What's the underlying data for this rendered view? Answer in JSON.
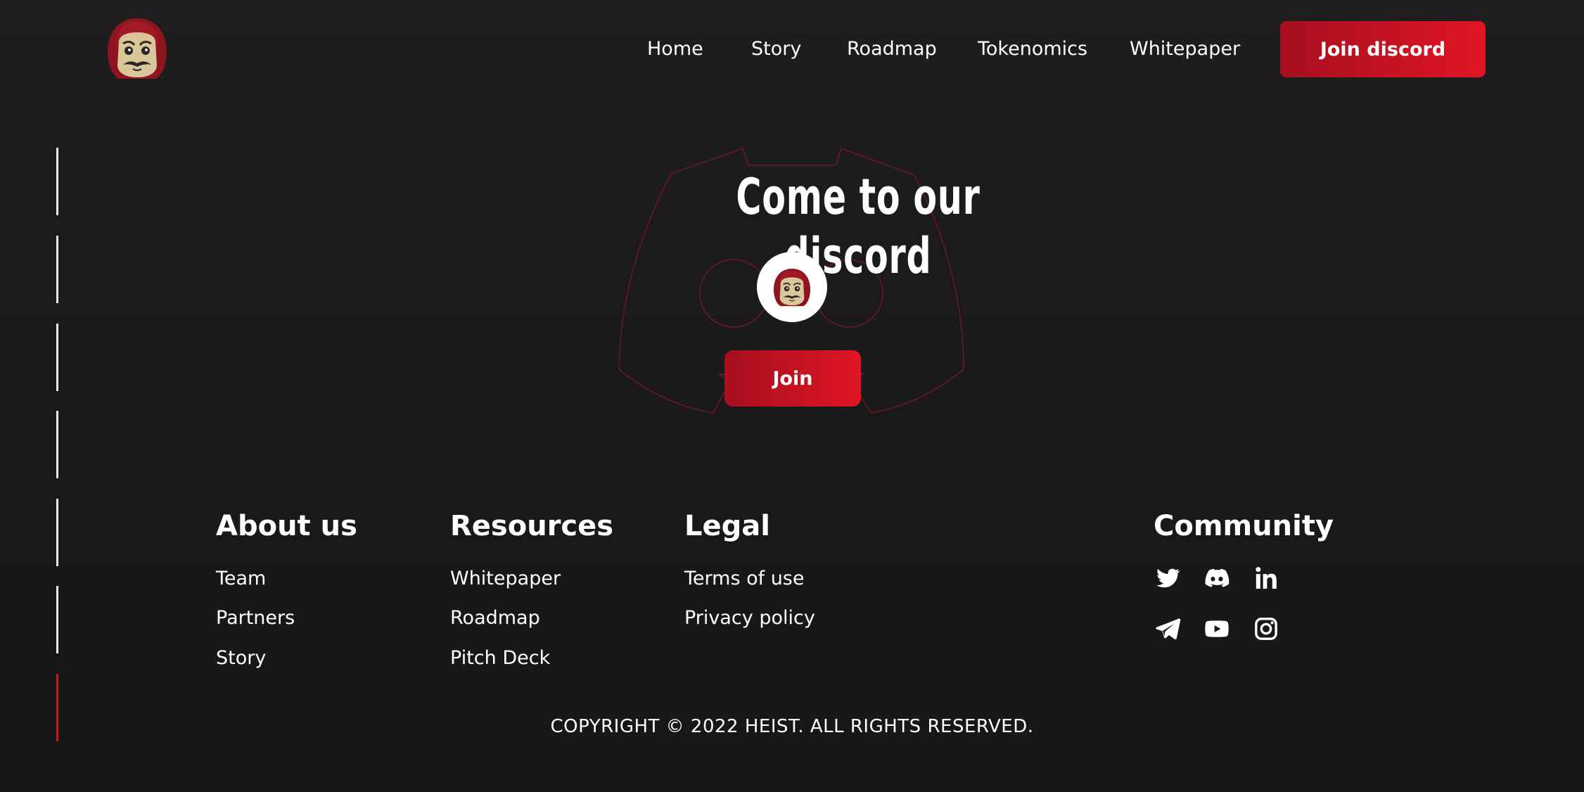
{
  "header": {
    "nav": [
      "Home",
      "Story",
      "Roadmap",
      "Tokenomics",
      "Whitepaper"
    ],
    "cta_label": "Join discord"
  },
  "discord": {
    "title": "Come to our discord",
    "join_label": "Join"
  },
  "footer": {
    "about": {
      "heading": "About us",
      "links": [
        "Team",
        "Partners",
        "Story"
      ]
    },
    "resources": {
      "heading": "Resources",
      "links": [
        "Whitepaper",
        "Roadmap",
        "Pitch Deck"
      ]
    },
    "legal": {
      "heading": "Legal",
      "links": [
        "Terms of use",
        "Privacy policy"
      ]
    },
    "community": {
      "heading": "Community",
      "icons": [
        "twitter-icon",
        "discord-icon",
        "linkedin-icon",
        "telegram-icon",
        "youtube-icon",
        "instagram-icon"
      ]
    },
    "copyright": "COPYRIGHT © 2022 HEIST. ALL RIGHTS RESERVED."
  },
  "progress": {
    "total_sections": 7,
    "active_section": 7
  },
  "colors": {
    "accent": "#d3141f",
    "accent_dark": "#a50f1f",
    "background": "#1b1a1b",
    "text": "#ffffff"
  }
}
